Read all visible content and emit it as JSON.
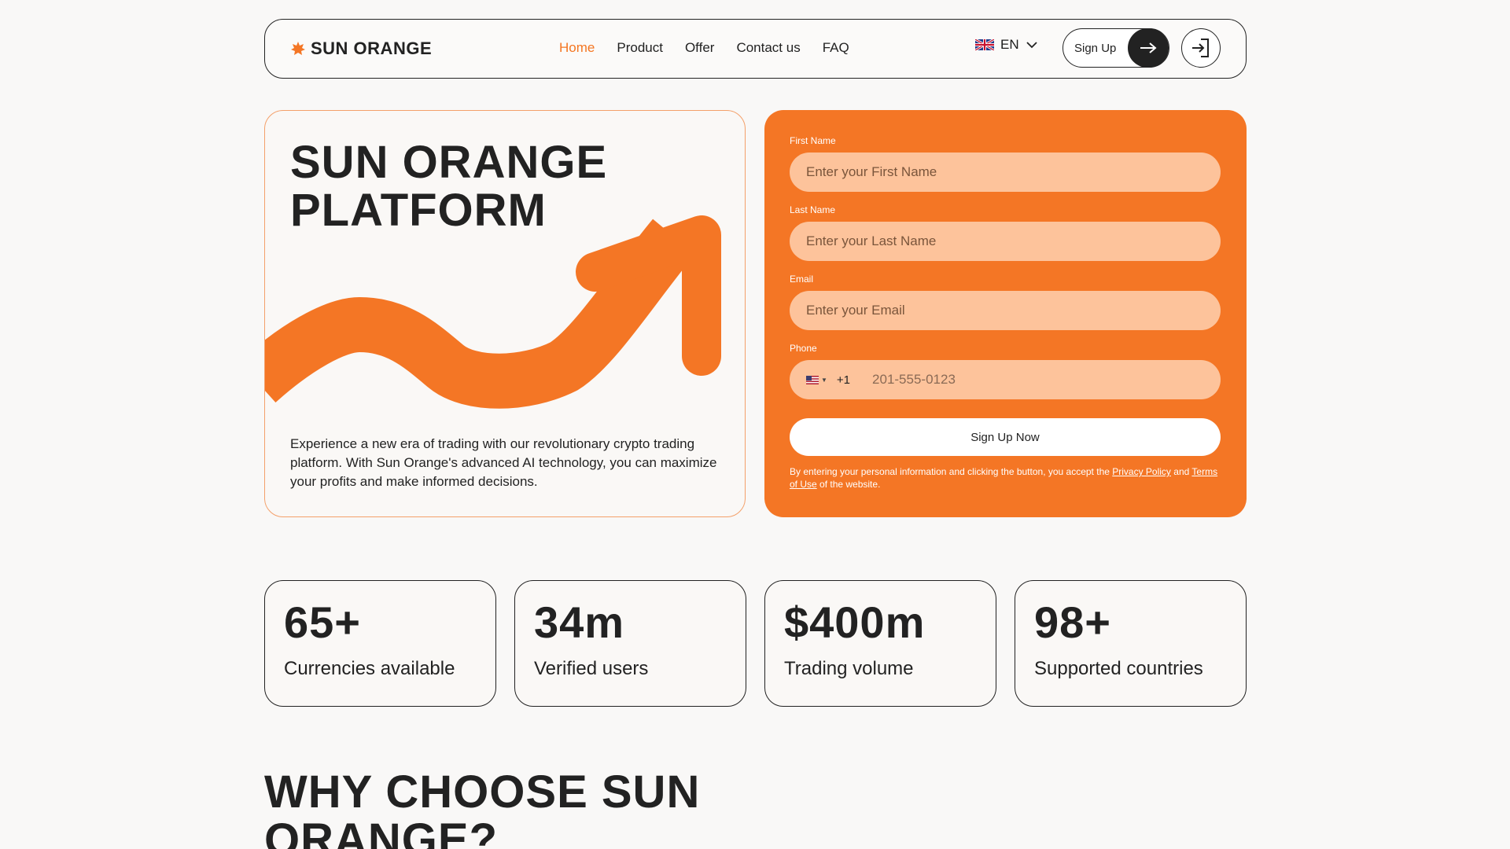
{
  "brand": {
    "name": "SUN ORANGE",
    "accent": "#f47625"
  },
  "nav": {
    "items": [
      {
        "label": "Home",
        "active": true
      },
      {
        "label": "Product",
        "active": false
      },
      {
        "label": "Offer",
        "active": false
      },
      {
        "label": "Contact us",
        "active": false
      },
      {
        "label": "FAQ",
        "active": false
      }
    ],
    "language": "EN",
    "signup_label": "Sign Up"
  },
  "hero": {
    "title": "SUN ORANGE\nPLATFORM",
    "description": "Experience a new era of trading with our revolutionary crypto trading platform. With Sun Orange's advanced AI technology, you can maximize your profits and make informed decisions."
  },
  "form": {
    "first_name": {
      "label": "First Name",
      "placeholder": "Enter your First Name"
    },
    "last_name": {
      "label": "Last Name",
      "placeholder": "Enter your Last Name"
    },
    "email": {
      "label": "Email",
      "placeholder": "Enter your Email"
    },
    "phone": {
      "label": "Phone",
      "country_code": "+1",
      "placeholder": "201-555-0123"
    },
    "submit_label": "Sign Up Now",
    "legal": {
      "prefix": "By entering your personal information and clicking the button, you accept the ",
      "privacy_link": "Privacy Policy",
      "middle": " and ",
      "terms_link": "Terms of Use",
      "suffix": " of the website."
    }
  },
  "stats": [
    {
      "value": "65+",
      "label": "Currencies available"
    },
    {
      "value": "34m",
      "label": "Verified users"
    },
    {
      "value": "$400m",
      "label": "Trading volume"
    },
    {
      "value": "98+",
      "label": "Supported countries"
    }
  ],
  "why_section": {
    "title": "WHY CHOOSE SUN\nORANGE?"
  }
}
